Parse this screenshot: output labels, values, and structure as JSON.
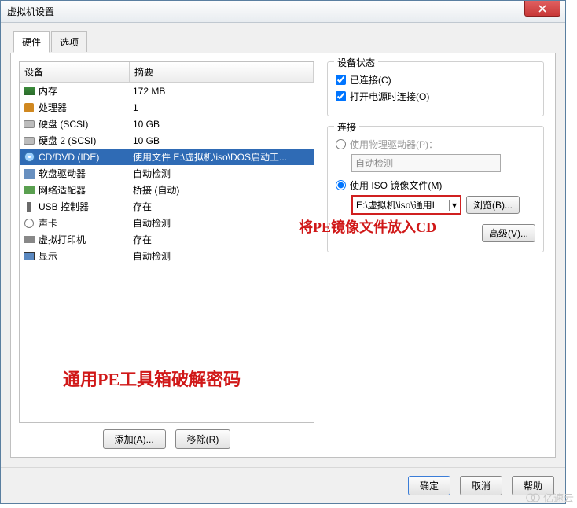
{
  "window": {
    "title": "虚拟机设置"
  },
  "tabs": {
    "hardware": "硬件",
    "options": "选项"
  },
  "table": {
    "headers": {
      "device": "设备",
      "summary": "摘要"
    },
    "rows": [
      {
        "icon": "memory-icon",
        "name": "内存",
        "summary": "172 MB"
      },
      {
        "icon": "cpu-icon",
        "name": "处理器",
        "summary": "1"
      },
      {
        "icon": "hdd-icon",
        "name": "硬盘 (SCSI)",
        "summary": "10 GB"
      },
      {
        "icon": "hdd-icon",
        "name": "硬盘 2 (SCSI)",
        "summary": "10 GB"
      },
      {
        "icon": "cd-icon",
        "name": "CD/DVD (IDE)",
        "summary": "使用文件 E:\\虚拟机\\iso\\DOS启动工..."
      },
      {
        "icon": "floppy-icon",
        "name": "软盘驱动器",
        "summary": "自动检测"
      },
      {
        "icon": "network-icon",
        "name": "网络适配器",
        "summary": "桥接 (自动)"
      },
      {
        "icon": "usb-icon",
        "name": "USB 控制器",
        "summary": "存在"
      },
      {
        "icon": "sound-icon",
        "name": "声卡",
        "summary": "自动检测"
      },
      {
        "icon": "printer-icon",
        "name": "虚拟打印机",
        "summary": "存在"
      },
      {
        "icon": "display-icon",
        "name": "显示",
        "summary": "自动检测"
      }
    ]
  },
  "selected_row_index": 4,
  "buttons": {
    "add": "添加(A)...",
    "remove": "移除(R)",
    "browse": "浏览(B)...",
    "advanced": "高级(V)...",
    "ok": "确定",
    "cancel": "取消",
    "help": "帮助"
  },
  "status_group": {
    "title": "设备状态",
    "connected": "已连接(C)",
    "connect_on_power": "打开电源时连接(O)"
  },
  "connection_group": {
    "title": "连接",
    "use_physical": "使用物理驱动器(P)：",
    "auto_detect": "自动检测",
    "use_iso": "使用 ISO 镜像文件(M)",
    "iso_path": "E:\\虚拟机\\iso\\通用I"
  },
  "annotations": {
    "cd_note": "将PE镜像文件放入CD",
    "main_note": "通用PE工具箱破解密码"
  },
  "watermark": "亿速云"
}
